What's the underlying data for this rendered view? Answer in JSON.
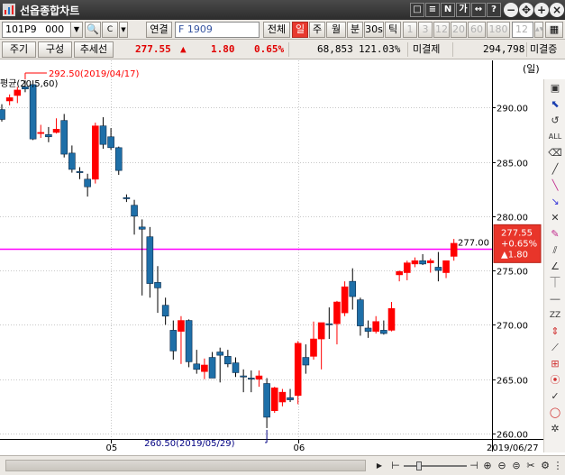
{
  "window": {
    "title": "선옵종합차트",
    "title_buttons": [
      "□",
      "≡",
      "N",
      "가",
      "↔",
      "?"
    ]
  },
  "toolbar1": {
    "code": "101P9",
    "code_suffix": "000",
    "link_label": "연결",
    "contract_name": "F 1909",
    "all_label": "전체",
    "periods": [
      "일",
      "주",
      "월",
      "분",
      "30s",
      "틱"
    ],
    "active_period": "일",
    "intervals": [
      "1",
      "3",
      "12",
      "20",
      "60",
      "180"
    ],
    "interval_value": "12"
  },
  "toolbar2": {
    "period_button": "주기",
    "compose_button": "구성",
    "trendline_button": "추세선",
    "price": "277.55",
    "change_arrow": "▲",
    "change": "1.80",
    "change_pct": "0.65%",
    "volume": "68,853",
    "vol_ratio": "121.03%",
    "open_interest_label": "미결제",
    "open_interest": "294,798",
    "open_interest_label2": "미결증"
  },
  "chart": {
    "ma_label": "평균(20,5,60)",
    "unit_label": "(일)",
    "high_annotation": "292.50(2019/04/17)",
    "low_annotation": "260.50(2019/05/29)",
    "hline_label": "277.00",
    "last_price_box": [
      "277.55",
      "+0.65%",
      "▲1.80"
    ],
    "x_labels": [
      "05",
      "06",
      "2019/06/27"
    ],
    "colors": {
      "up": "#ff0000",
      "down": "#1e6fa8",
      "hline": "#ff00ff",
      "annotation_red": "#ff0000",
      "annotation_blue": "#000080"
    }
  },
  "chart_data": {
    "type": "candlestick",
    "y_ticks": [
      "290.00",
      "285.00",
      "280.00",
      "275.00",
      "270.00",
      "265.00",
      "260.00"
    ],
    "ylim": [
      259.5,
      293.5
    ],
    "hline": 277.0,
    "last_price": 277.55,
    "candles": [
      [
        289.8,
        290.3,
        288.7,
        288.9
      ],
      [
        290.6,
        291.2,
        290.2,
        290.9
      ],
      [
        291.1,
        291.9,
        290.4,
        291.6
      ],
      [
        291.9,
        292.5,
        291.4,
        291.7
      ],
      [
        292.1,
        292.5,
        287.0,
        287.1
      ],
      [
        287.6,
        288.4,
        287.2,
        287.7
      ],
      [
        287.5,
        288.2,
        286.8,
        287.3
      ],
      [
        287.7,
        289.0,
        287.6,
        288.0
      ],
      [
        288.8,
        289.4,
        285.4,
        285.7
      ],
      [
        285.8,
        286.5,
        284.0,
        284.3
      ],
      [
        284.1,
        284.5,
        283.4,
        284.0
      ],
      [
        283.4,
        283.9,
        281.8,
        282.7
      ],
      [
        283.4,
        288.6,
        283.0,
        288.3
      ],
      [
        288.3,
        289.1,
        286.2,
        286.6
      ],
      [
        287.3,
        288.1,
        286.1,
        286.3
      ],
      [
        286.3,
        286.4,
        283.8,
        284.2
      ],
      [
        281.7,
        282.0,
        281.3,
        281.6
      ],
      [
        281.0,
        281.5,
        278.3,
        280.0
      ],
      [
        279.0,
        279.7,
        272.7,
        278.8
      ],
      [
        278.1,
        279.0,
        272.5,
        273.8
      ],
      [
        273.9,
        275.4,
        271.1,
        273.4
      ],
      [
        271.8,
        272.5,
        270.0,
        270.8
      ],
      [
        269.5,
        270.4,
        266.8,
        267.6
      ],
      [
        269.4,
        270.8,
        266.4,
        270.4
      ],
      [
        270.4,
        270.5,
        266.1,
        266.6
      ],
      [
        266.4,
        267.7,
        265.5,
        265.9
      ],
      [
        265.7,
        266.9,
        265.0,
        266.3
      ],
      [
        267.0,
        267.5,
        265.2,
        265.1
      ],
      [
        267.5,
        267.9,
        264.7,
        267.2
      ],
      [
        267.1,
        267.7,
        266.1,
        266.4
      ],
      [
        266.5,
        267.0,
        265.2,
        265.6
      ],
      [
        265.3,
        265.9,
        263.8,
        265.2
      ],
      [
        265.1,
        265.8,
        263.8,
        265.0
      ],
      [
        265.0,
        265.8,
        264.3,
        265.3
      ],
      [
        264.6,
        265.1,
        260.5,
        261.5
      ],
      [
        262.1,
        264.3,
        261.9,
        264.2
      ],
      [
        262.9,
        264.1,
        262.5,
        263.8
      ],
      [
        263.3,
        264.1,
        262.9,
        263.1
      ],
      [
        263.5,
        268.5,
        262.7,
        268.3
      ],
      [
        267.0,
        268.2,
        265.5,
        266.3
      ],
      [
        267.1,
        270.3,
        266.8,
        268.7
      ],
      [
        268.7,
        270.1,
        265.9,
        270.2
      ],
      [
        270.1,
        271.6,
        268.7,
        270.0
      ],
      [
        270.1,
        272.2,
        268.2,
        272.1
      ],
      [
        271.1,
        274.0,
        270.8,
        273.5
      ],
      [
        274.0,
        275.2,
        271.4,
        272.6
      ],
      [
        272.3,
        272.5,
        269.0,
        269.9
      ],
      [
        269.7,
        270.4,
        268.8,
        269.4
      ],
      [
        269.4,
        270.8,
        269.2,
        270.3
      ],
      [
        269.5,
        270.4,
        269.1,
        269.2
      ],
      [
        269.5,
        272.1,
        269.4,
        271.5
      ],
      [
        274.6,
        275.0,
        274.0,
        274.9
      ],
      [
        274.8,
        275.9,
        274.1,
        275.7
      ],
      [
        275.6,
        276.2,
        275.3,
        275.9
      ],
      [
        275.9,
        276.5,
        275.5,
        275.6
      ],
      [
        275.7,
        276.1,
        274.8,
        275.9
      ],
      [
        275.3,
        276.7,
        274.0,
        275.0
      ],
      [
        274.8,
        275.4,
        274.3,
        275.9
      ],
      [
        276.3,
        277.9,
        275.9,
        277.5
      ]
    ],
    "high_label_idx": 3,
    "low_label_idx": 34,
    "xtick_indices": [
      14,
      38
    ]
  }
}
